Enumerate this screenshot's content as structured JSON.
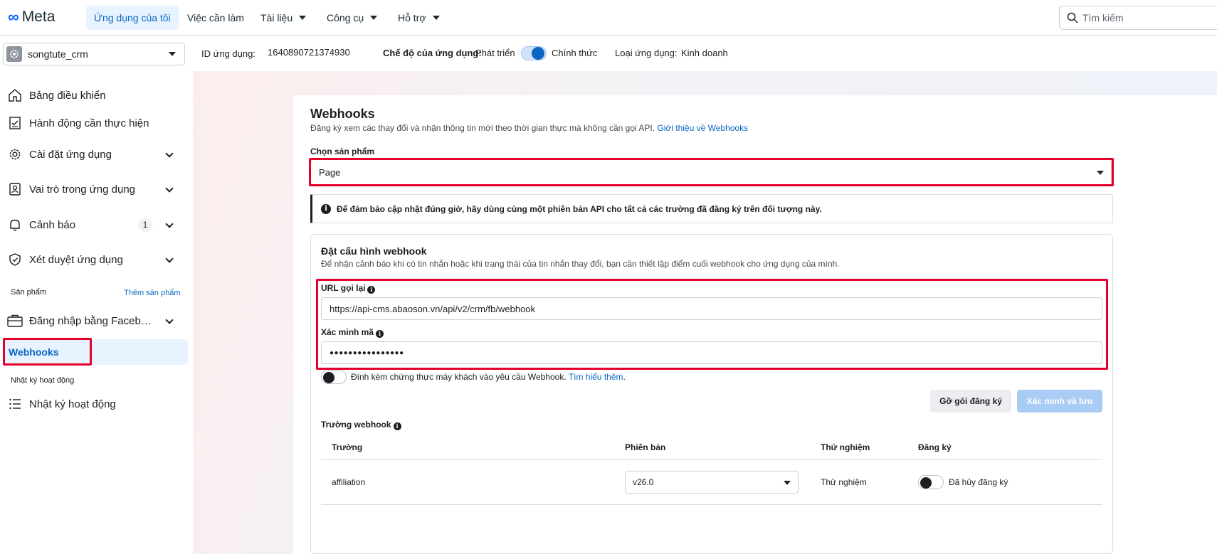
{
  "topnav": {
    "logo_text": "Meta",
    "items": [
      {
        "label": "Ứng dụng của tôi",
        "active": true
      },
      {
        "label": "Việc cần làm"
      },
      {
        "label": "Tài liệu"
      },
      {
        "label": "Công cụ"
      },
      {
        "label": "Hỗ trợ"
      }
    ],
    "search_placeholder": "Tìm kiếm"
  },
  "appbar": {
    "app_name": "songtute_crm",
    "app_id_label": "ID ứng dụng:",
    "app_id": "1640890721374930",
    "mode_label": "Chế độ của ứng dụng:",
    "mode_dev": "Phát triển",
    "mode_live": "Chính thức",
    "type_label": "Loại ứng dụng:",
    "type_value": "Kinh doanh"
  },
  "sidebar": {
    "items": [
      {
        "label": "Bảng điều khiển",
        "icon": "home-icon"
      },
      {
        "label": "Hành động cần thực hiện",
        "icon": "checklist-icon"
      },
      {
        "label": "Cài đặt ứng dụng",
        "icon": "gear-icon"
      },
      {
        "label": "Vai trò trong ứng dụng",
        "icon": "id-badge-icon"
      },
      {
        "label": "Cảnh báo",
        "icon": "bell-icon",
        "badge": "1"
      },
      {
        "label": "Xét duyệt ứng dụng",
        "icon": "shield-check-icon"
      }
    ],
    "products_section": "Sản phẩm",
    "add_product": "Thêm sản phẩm",
    "fb_login": "Đăng nhập bằng Faceb…",
    "webhooks": "Webhooks",
    "activity_section": "Nhật ký hoạt động",
    "activity_item": "Nhật ký hoạt động"
  },
  "main": {
    "title": "Webhooks",
    "subtitle": "Đăng ký xem các thay đổi và nhận thông tin mới theo thời gian thực mà không cần gọi API.",
    "subtitle_link": "Giới thiệu về Webhooks",
    "product_label": "Chọn sản phẩm",
    "product_value": "Page",
    "notice": "Để đảm bảo cập nhật đúng giờ, hãy dùng cùng một phiên bản API cho tất cả các trường đã đăng ký trên đối tượng này.",
    "config_title": "Đặt cấu hình webhook",
    "config_desc": "Để nhận cảnh báo khi có tin nhắn hoặc khi trạng thái của tin nhắn thay đổi, bạn cần thiết lập điểm cuối webhook cho ứng dụng của mình.",
    "callback_label": "URL gọi lại",
    "callback_value": "https://api-cms.abaoson.vn/api/v2/crm/fb/webhook",
    "verify_label": "Xác minh mã",
    "verify_value": "●●●●●●●●●●●●●●●●",
    "client_cert_text": "Đính kèm chứng thực máy khách vào yêu cầu Webhook.",
    "client_cert_link": "Tìm hiểu thêm",
    "unsubscribe_button": "Gỡ gói đăng ký",
    "verify_save_button": "Xác minh và lưu",
    "fields_label": "Trường webhook",
    "table_headers": [
      "Trường",
      "Phiên bản",
      "Thử nghiệm",
      "Đăng ký"
    ],
    "rows": [
      {
        "field": "affiliation",
        "version": "v26.0",
        "test": "Thử nghiệm",
        "status": "Đã hủy đăng ký"
      }
    ]
  },
  "colors": {
    "accent": "#0a66c2",
    "highlight_box": "#e4002b"
  }
}
